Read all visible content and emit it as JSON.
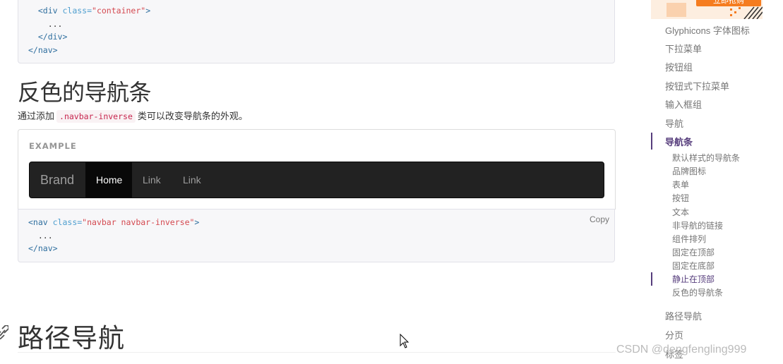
{
  "top_code": {
    "lines": [
      {
        "indent": "  ",
        "open": "<div ",
        "attr": "class=",
        "val": "\"container\"",
        "close": ">"
      },
      {
        "indent": "    ",
        "text": "..."
      },
      {
        "indent": "  ",
        "tag": "</div>"
      },
      {
        "indent": "",
        "tag": "</nav>"
      }
    ]
  },
  "inverse": {
    "title": "反色的导航条",
    "desc_before": "通过添加",
    "desc_code": ".navbar-inverse",
    "desc_after": "类可以改变导航条的外观。",
    "example_label": "EXAMPLE",
    "navbar": {
      "brand": "Brand",
      "items": [
        "Home",
        "Link",
        "Link"
      ]
    },
    "code": {
      "open": "<nav ",
      "attr": "class=",
      "val": "\"navbar navbar-inverse\"",
      "close": ">",
      "dots": "...",
      "end": "</nav>"
    },
    "copy_label": "Copy"
  },
  "breadcrumb": {
    "title": "路径导航"
  },
  "sidebar": {
    "ad_button": "立即抢购",
    "links": [
      "Glyphicons 字体图标",
      "下拉菜单",
      "按钮组",
      "按钮式下拉菜单",
      "输入框组",
      "导航",
      "导航条"
    ],
    "sub_links": [
      "默认样式的导航条",
      "品牌图标",
      "表单",
      "按钮",
      "文本",
      "非导航的链接",
      "组件排列",
      "固定在顶部",
      "固定在底部",
      "静止在顶部",
      "反色的导航条"
    ],
    "after_links": [
      "路径导航",
      "分页",
      "标签"
    ]
  },
  "watermark": "CSDN @dengfengling999",
  "colors": {
    "accent": "#563d7c",
    "navbar_bg": "#222222",
    "code_red": "#c7254e"
  }
}
